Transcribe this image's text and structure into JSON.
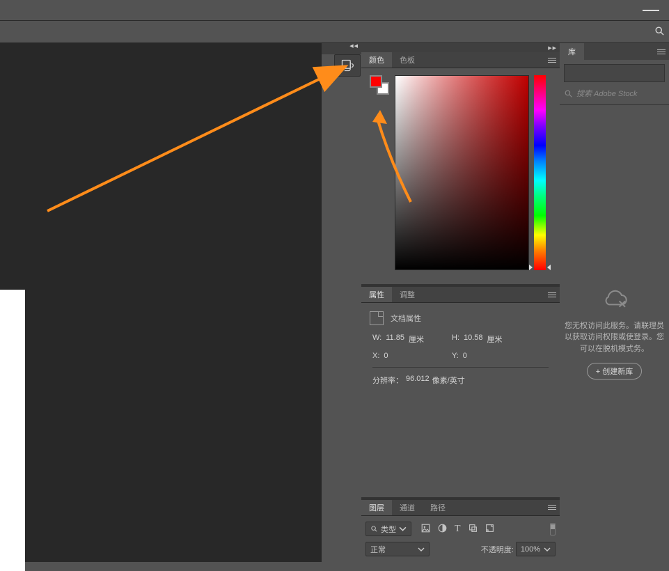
{
  "window": {
    "minimize_icon": "minimize"
  },
  "search": {
    "placeholder": "搜索"
  },
  "color_panel": {
    "tab_color": "颜色",
    "tab_swatches": "色板",
    "foreground": "#ff0000",
    "background": "#ffffff"
  },
  "properties_panel": {
    "tab_properties": "属性",
    "tab_adjust": "调整",
    "doc_props_label": "文档属性",
    "W_label": "W:",
    "W_value": "11.85",
    "W_unit": "厘米",
    "H_label": "H:",
    "H_value": "10.58",
    "H_unit": "厘米",
    "X_label": "X:",
    "X_value": "0",
    "Y_label": "Y:",
    "Y_value": "0",
    "resolution_label": "分辨率：",
    "resolution_value": "96.012",
    "resolution_unit": "像素/英寸"
  },
  "layers_panel": {
    "tab_layers": "图层",
    "tab_channels": "通道",
    "tab_paths": "路径",
    "kind_prefix": "ρ",
    "kind_label": "类型",
    "blend_mode": "正常",
    "opacity_label": "不透明度:",
    "opacity_value": "100%"
  },
  "library_panel": {
    "tab_library": "库",
    "search_placeholder": "搜索 Adobe Stock",
    "message": "您无权访问此服务。请联理员以获取访问权限或使登录。您可以在脱机模式务。",
    "create_button": "+ 创建新库"
  }
}
